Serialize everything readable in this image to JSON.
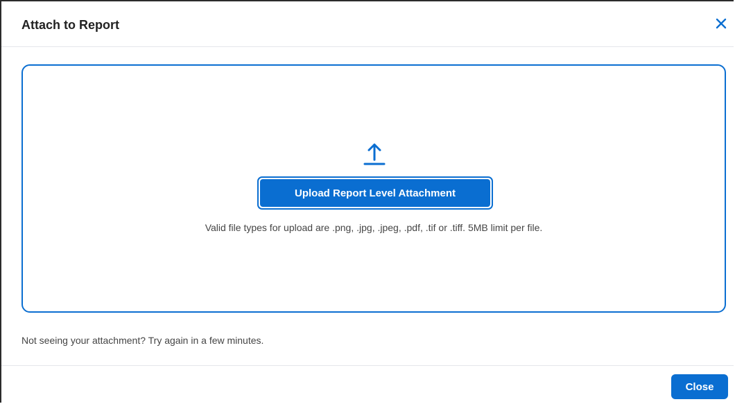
{
  "dialog": {
    "title": "Attach to Report",
    "close_icon": "close-icon"
  },
  "dropzone": {
    "icon": "upload-arrow-icon",
    "upload_button_label": "Upload Report Level Attachment",
    "file_types_text": "Valid file types for upload are .png, .jpg, .jpeg, .pdf, .tif or .tiff. 5MB limit per file."
  },
  "hint_text": "Not seeing your attachment? Try again in a few minutes.",
  "footer": {
    "close_label": "Close"
  },
  "colors": {
    "accent": "#0a6ed1",
    "text": "#222222",
    "muted_text": "#444444"
  }
}
